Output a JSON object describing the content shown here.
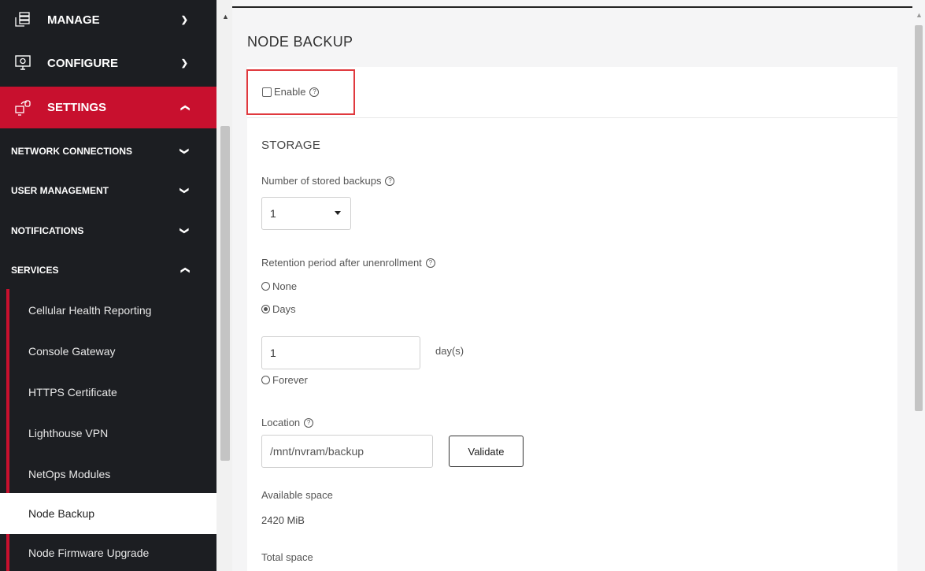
{
  "sidebar": {
    "top_items": [
      {
        "label": "MANAGE",
        "icon": "server-stack-icon",
        "chevron": "⌄"
      },
      {
        "label": "CONFIGURE",
        "icon": "monitor-gear-icon",
        "chevron": "⌄"
      },
      {
        "label": "SETTINGS",
        "icon": "computer-sync-icon",
        "chevron": "⌃"
      }
    ],
    "sub_items": [
      {
        "label": "NETWORK CONNECTIONS",
        "chevron": "⌄"
      },
      {
        "label": "USER MANAGEMENT",
        "chevron": "⌄"
      },
      {
        "label": "NOTIFICATIONS",
        "chevron": "⌄"
      },
      {
        "label": "SERVICES",
        "chevron": "⌃"
      }
    ],
    "service_items": [
      {
        "label": "Cellular Health Reporting"
      },
      {
        "label": "Console Gateway"
      },
      {
        "label": "HTTPS Certificate"
      },
      {
        "label": "Lighthouse VPN"
      },
      {
        "label": "NetOps Modules"
      },
      {
        "label": "Node Backup",
        "active": true
      },
      {
        "label": "Node Firmware Upgrade"
      }
    ],
    "accent_color": "#c8102e",
    "background_color": "#1c1e22"
  },
  "page": {
    "title": "NODE BACKUP",
    "enable_label": "Enable",
    "enable_checked": false,
    "storage": {
      "title": "STORAGE",
      "num_backups_label": "Number of stored backups",
      "num_backups_value": "1",
      "retention_label": "Retention period after unenrollment",
      "retention_options": [
        "None",
        "Days",
        "Forever"
      ],
      "retention_selected": "Days",
      "days_value": "1",
      "days_unit": "day(s)",
      "location_label": "Location",
      "location_value": "/mnt/nvram/backup",
      "validate_label": "Validate",
      "available_label": "Available space",
      "available_value": "2420 MiB",
      "total_label": "Total space"
    },
    "help_glyph": "?"
  },
  "colors": {
    "highlight_border": "#e0393e"
  }
}
